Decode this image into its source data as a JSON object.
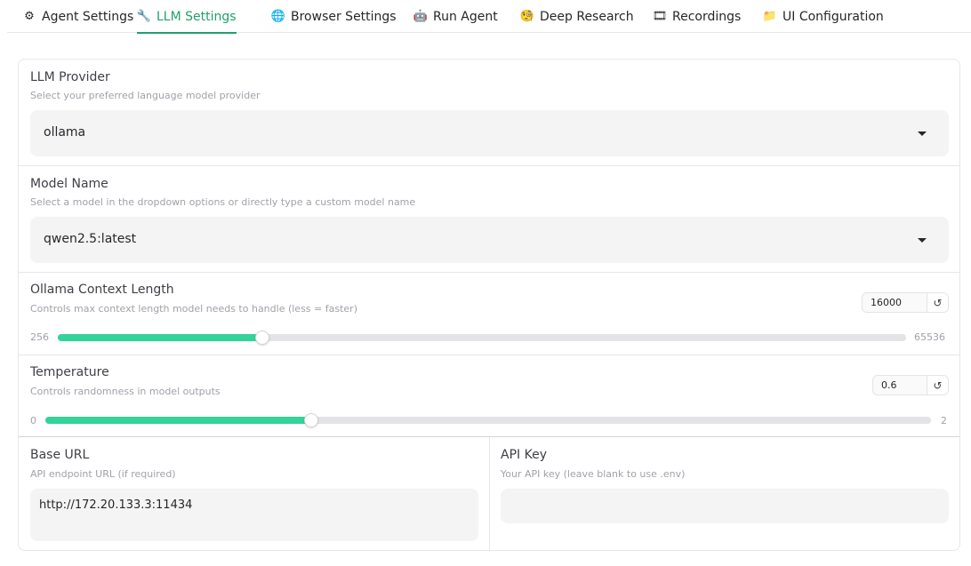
{
  "tabs": [
    {
      "label": "Agent Settings",
      "icon": "gear-icon",
      "glyph": "⚙"
    },
    {
      "label": "LLM Settings",
      "icon": "wrench-icon",
      "glyph": "🔧"
    },
    {
      "label": "Browser Settings",
      "icon": "globe-icon",
      "glyph": "🌐"
    },
    {
      "label": "Run Agent",
      "icon": "robot-icon",
      "glyph": "🤖"
    },
    {
      "label": "Deep Research",
      "icon": "face-icon",
      "glyph": "🧐"
    },
    {
      "label": "Recordings",
      "icon": "film-icon",
      "glyph": "🎞"
    },
    {
      "label": "UI Configuration",
      "icon": "folder-icon",
      "glyph": "📁"
    }
  ],
  "active_tab": "LLM Settings",
  "accent_color": "#22a06b",
  "slider_color": "#34d399",
  "llm_provider": {
    "label": "LLM Provider",
    "info": "Select your preferred language model provider",
    "value": "ollama"
  },
  "model_name": {
    "label": "Model Name",
    "info": "Select a model in the dropdown options or directly type a custom model name",
    "value": "qwen2.5:latest"
  },
  "context_length": {
    "label": "Ollama Context Length",
    "info": "Controls max context length model needs to handle (less = faster)",
    "value": "16000",
    "min": "256",
    "max": "65536",
    "fraction": 0.241
  },
  "temperature": {
    "label": "Temperature",
    "info": "Controls randomness in model outputs",
    "value": "0.6",
    "min": "0",
    "max": "2",
    "fraction": 0.3
  },
  "base_url": {
    "label": "Base URL",
    "info": "API endpoint URL (if required)",
    "value": "http://172.20.133.3:11434"
  },
  "api_key": {
    "label": "API Key",
    "info": "Your API key (leave blank to use .env)",
    "value": ""
  }
}
